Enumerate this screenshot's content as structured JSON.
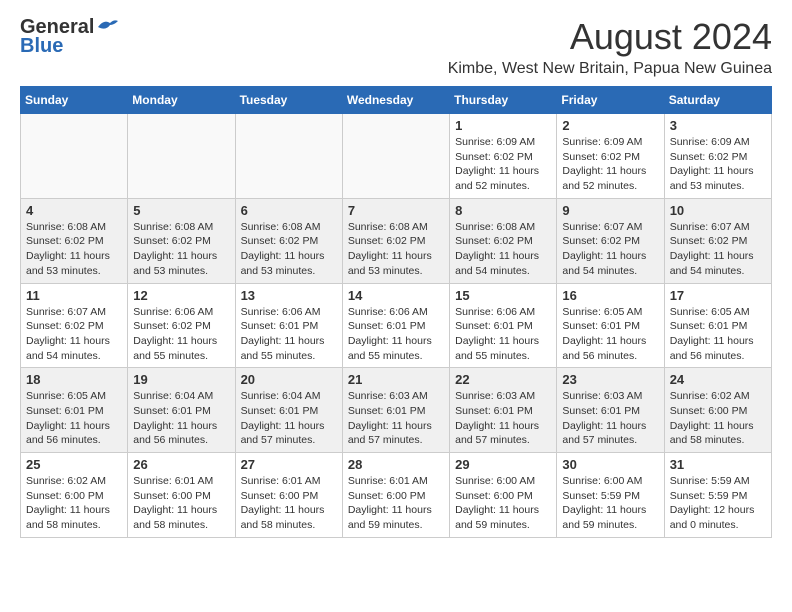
{
  "header": {
    "logo_general": "General",
    "logo_blue": "Blue",
    "month": "August 2024",
    "location": "Kimbe, West New Britain, Papua New Guinea"
  },
  "weekdays": [
    "Sunday",
    "Monday",
    "Tuesday",
    "Wednesday",
    "Thursday",
    "Friday",
    "Saturday"
  ],
  "weeks": [
    [
      {
        "day": "",
        "info": ""
      },
      {
        "day": "",
        "info": ""
      },
      {
        "day": "",
        "info": ""
      },
      {
        "day": "",
        "info": ""
      },
      {
        "day": "1",
        "info": "Sunrise: 6:09 AM\nSunset: 6:02 PM\nDaylight: 11 hours and 52 minutes."
      },
      {
        "day": "2",
        "info": "Sunrise: 6:09 AM\nSunset: 6:02 PM\nDaylight: 11 hours and 52 minutes."
      },
      {
        "day": "3",
        "info": "Sunrise: 6:09 AM\nSunset: 6:02 PM\nDaylight: 11 hours and 53 minutes."
      }
    ],
    [
      {
        "day": "4",
        "info": "Sunrise: 6:08 AM\nSunset: 6:02 PM\nDaylight: 11 hours and 53 minutes."
      },
      {
        "day": "5",
        "info": "Sunrise: 6:08 AM\nSunset: 6:02 PM\nDaylight: 11 hours and 53 minutes."
      },
      {
        "day": "6",
        "info": "Sunrise: 6:08 AM\nSunset: 6:02 PM\nDaylight: 11 hours and 53 minutes."
      },
      {
        "day": "7",
        "info": "Sunrise: 6:08 AM\nSunset: 6:02 PM\nDaylight: 11 hours and 53 minutes."
      },
      {
        "day": "8",
        "info": "Sunrise: 6:08 AM\nSunset: 6:02 PM\nDaylight: 11 hours and 54 minutes."
      },
      {
        "day": "9",
        "info": "Sunrise: 6:07 AM\nSunset: 6:02 PM\nDaylight: 11 hours and 54 minutes."
      },
      {
        "day": "10",
        "info": "Sunrise: 6:07 AM\nSunset: 6:02 PM\nDaylight: 11 hours and 54 minutes."
      }
    ],
    [
      {
        "day": "11",
        "info": "Sunrise: 6:07 AM\nSunset: 6:02 PM\nDaylight: 11 hours and 54 minutes."
      },
      {
        "day": "12",
        "info": "Sunrise: 6:06 AM\nSunset: 6:02 PM\nDaylight: 11 hours and 55 minutes."
      },
      {
        "day": "13",
        "info": "Sunrise: 6:06 AM\nSunset: 6:01 PM\nDaylight: 11 hours and 55 minutes."
      },
      {
        "day": "14",
        "info": "Sunrise: 6:06 AM\nSunset: 6:01 PM\nDaylight: 11 hours and 55 minutes."
      },
      {
        "day": "15",
        "info": "Sunrise: 6:06 AM\nSunset: 6:01 PM\nDaylight: 11 hours and 55 minutes."
      },
      {
        "day": "16",
        "info": "Sunrise: 6:05 AM\nSunset: 6:01 PM\nDaylight: 11 hours and 56 minutes."
      },
      {
        "day": "17",
        "info": "Sunrise: 6:05 AM\nSunset: 6:01 PM\nDaylight: 11 hours and 56 minutes."
      }
    ],
    [
      {
        "day": "18",
        "info": "Sunrise: 6:05 AM\nSunset: 6:01 PM\nDaylight: 11 hours and 56 minutes."
      },
      {
        "day": "19",
        "info": "Sunrise: 6:04 AM\nSunset: 6:01 PM\nDaylight: 11 hours and 56 minutes."
      },
      {
        "day": "20",
        "info": "Sunrise: 6:04 AM\nSunset: 6:01 PM\nDaylight: 11 hours and 57 minutes."
      },
      {
        "day": "21",
        "info": "Sunrise: 6:03 AM\nSunset: 6:01 PM\nDaylight: 11 hours and 57 minutes."
      },
      {
        "day": "22",
        "info": "Sunrise: 6:03 AM\nSunset: 6:01 PM\nDaylight: 11 hours and 57 minutes."
      },
      {
        "day": "23",
        "info": "Sunrise: 6:03 AM\nSunset: 6:01 PM\nDaylight: 11 hours and 57 minutes."
      },
      {
        "day": "24",
        "info": "Sunrise: 6:02 AM\nSunset: 6:00 PM\nDaylight: 11 hours and 58 minutes."
      }
    ],
    [
      {
        "day": "25",
        "info": "Sunrise: 6:02 AM\nSunset: 6:00 PM\nDaylight: 11 hours and 58 minutes."
      },
      {
        "day": "26",
        "info": "Sunrise: 6:01 AM\nSunset: 6:00 PM\nDaylight: 11 hours and 58 minutes."
      },
      {
        "day": "27",
        "info": "Sunrise: 6:01 AM\nSunset: 6:00 PM\nDaylight: 11 hours and 58 minutes."
      },
      {
        "day": "28",
        "info": "Sunrise: 6:01 AM\nSunset: 6:00 PM\nDaylight: 11 hours and 59 minutes."
      },
      {
        "day": "29",
        "info": "Sunrise: 6:00 AM\nSunset: 6:00 PM\nDaylight: 11 hours and 59 minutes."
      },
      {
        "day": "30",
        "info": "Sunrise: 6:00 AM\nSunset: 5:59 PM\nDaylight: 11 hours and 59 minutes."
      },
      {
        "day": "31",
        "info": "Sunrise: 5:59 AM\nSunset: 5:59 PM\nDaylight: 12 hours and 0 minutes."
      }
    ]
  ]
}
